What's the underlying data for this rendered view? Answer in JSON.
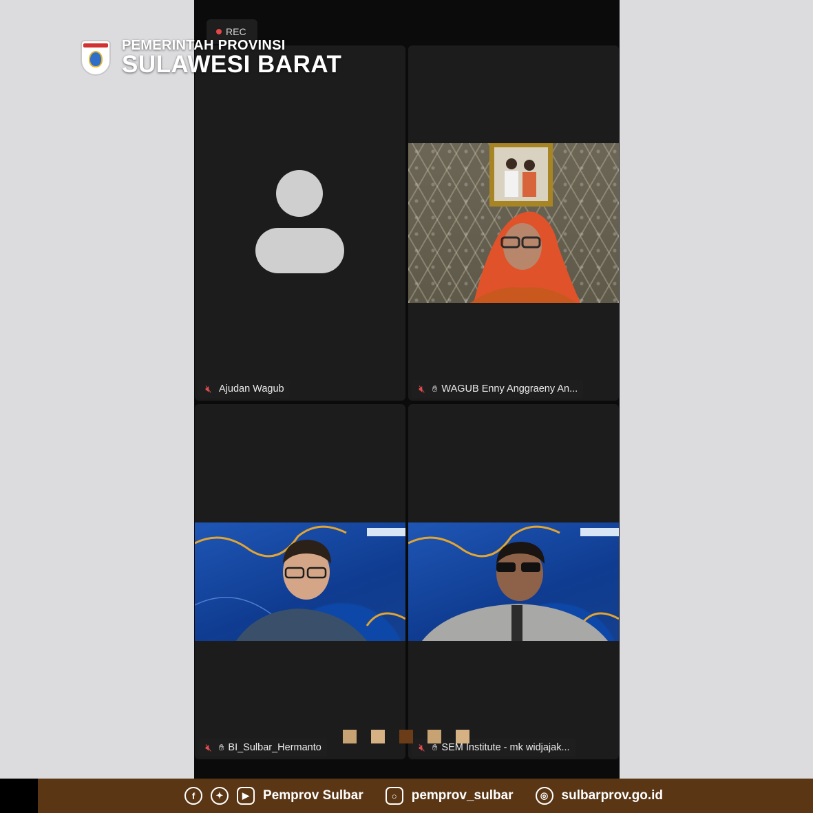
{
  "header": {
    "org_line": "PEMERINTAH PROVINSI",
    "org_name": "SULAWESI BARAT",
    "logo_text": "SULAWESI BARAT"
  },
  "meeting": {
    "rec_label": "REC",
    "participants": [
      {
        "name": "Ajudan Wagub",
        "muted": true,
        "hand_raised": false,
        "video": "avatar-placeholder"
      },
      {
        "name": "WAGUB Enny Anggraeny An...",
        "muted": true,
        "hand_raised": true,
        "video": "camera"
      },
      {
        "name": "BI_Sulbar_Hermanto",
        "muted": true,
        "hand_raised": true,
        "video": "camera"
      },
      {
        "name": "SEM Institute - mk widjajak...",
        "muted": true,
        "hand_raised": true,
        "video": "camera"
      }
    ]
  },
  "decor_colors": [
    "#c7a272",
    "#d5b183",
    "#6a3d18",
    "#c7a272",
    "#d5b183"
  ],
  "footer": {
    "social_handle": "Pemprov Sulbar",
    "instagram": "pemprov_sulbar",
    "website": "sulbarprov.go.id",
    "icons": [
      "facebook-icon",
      "twitter-icon",
      "youtube-icon",
      "instagram-icon",
      "web-icon"
    ]
  }
}
